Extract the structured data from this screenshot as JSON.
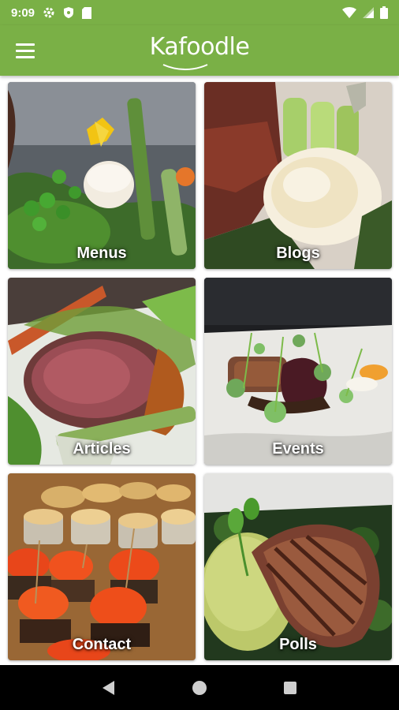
{
  "status_bar": {
    "time": "9:09"
  },
  "app_bar": {
    "logo_text": "Kafoodle",
    "brand_color": "#7ab046"
  },
  "tiles": [
    {
      "label": "Menus",
      "icon": "peas-scallop-photo"
    },
    {
      "label": "Blogs",
      "icon": "poached-egg-photo"
    },
    {
      "label": "Articles",
      "icon": "lamb-carrot-photo"
    },
    {
      "label": "Events",
      "icon": "microgreens-plate-photo"
    },
    {
      "label": "Contact",
      "icon": "sliders-tray-photo"
    },
    {
      "label": "Polls",
      "icon": "grilled-salmon-photo"
    }
  ]
}
